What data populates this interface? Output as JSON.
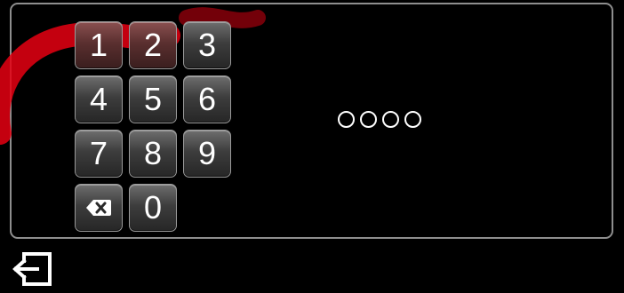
{
  "keypad": {
    "rows": [
      [
        {
          "label": "1",
          "name": "key-1"
        },
        {
          "label": "2",
          "name": "key-2"
        },
        {
          "label": "3",
          "name": "key-3"
        }
      ],
      [
        {
          "label": "4",
          "name": "key-4"
        },
        {
          "label": "5",
          "name": "key-5"
        },
        {
          "label": "6",
          "name": "key-6"
        }
      ],
      [
        {
          "label": "7",
          "name": "key-7"
        },
        {
          "label": "8",
          "name": "key-8"
        },
        {
          "label": "9",
          "name": "key-9"
        }
      ]
    ],
    "backspace_icon": "backspace-icon",
    "zero_label": "0"
  },
  "pin": {
    "length": 4,
    "entered": 0
  },
  "exit": {
    "icon": "exit-icon"
  },
  "colors": {
    "background": "#000000",
    "key_text": "#ffffff",
    "panel_border": "#8e8e8e",
    "watermark": "#e60012"
  }
}
